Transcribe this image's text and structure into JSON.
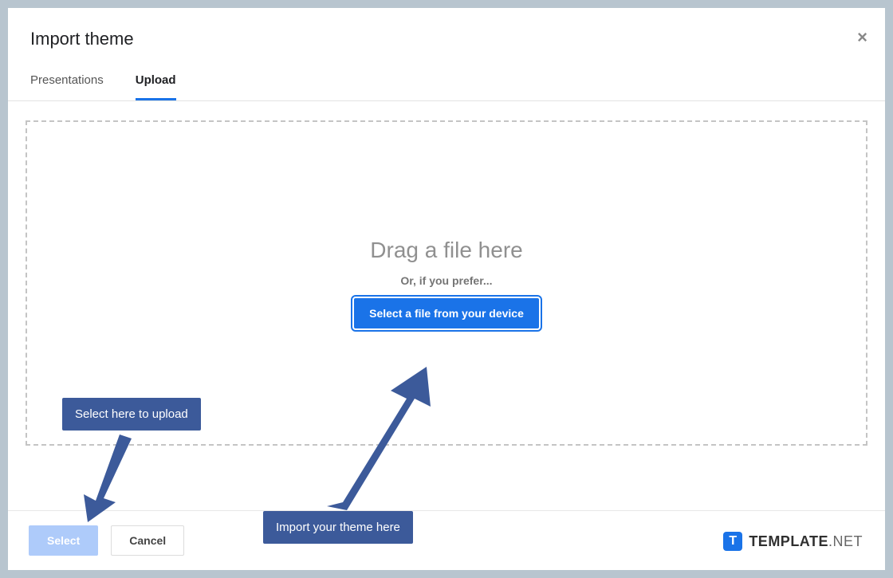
{
  "dialog": {
    "title": "Import theme",
    "close_label": "×"
  },
  "tabs": {
    "presentations": "Presentations",
    "upload": "Upload"
  },
  "dropzone": {
    "title": "Drag a file here",
    "subtitle": "Or, if you prefer...",
    "button": "Select a file from your device"
  },
  "footer": {
    "select": "Select",
    "cancel": "Cancel"
  },
  "callouts": {
    "left": "Select here to upload",
    "right": "Import your theme here"
  },
  "watermark": {
    "logo_letter": "T",
    "bold": "TEMPLATE",
    "thin": ".NET"
  }
}
